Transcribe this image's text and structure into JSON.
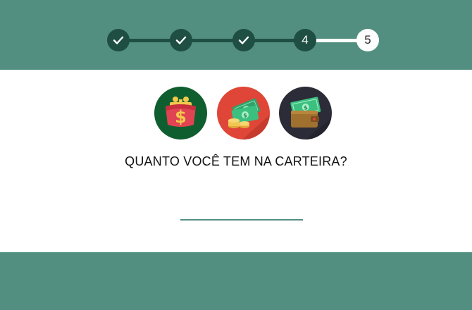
{
  "stepper": {
    "steps": [
      {
        "state": "done",
        "icon": "check-icon",
        "label": ""
      },
      {
        "state": "done",
        "icon": "check-icon",
        "label": ""
      },
      {
        "state": "done",
        "icon": "check-icon",
        "label": ""
      },
      {
        "state": "current",
        "icon": "",
        "label": "4"
      },
      {
        "state": "upcoming",
        "icon": "",
        "label": "5"
      }
    ]
  },
  "icons": [
    {
      "name": "coin-purse-icon",
      "bg": "#0f5e2f"
    },
    {
      "name": "cash-and-coins-icon",
      "bg": "#df4637"
    },
    {
      "name": "wallet-with-cash-icon",
      "bg": "#2c2c38"
    }
  ],
  "main": {
    "question": "QUANTO VOCÊ TEM NA CARTEIRA?",
    "amount": {
      "value": "",
      "placeholder": ""
    }
  },
  "colors": {
    "accent": "#528f80",
    "dark_accent": "#1f4e43",
    "background": "#ffffff"
  }
}
